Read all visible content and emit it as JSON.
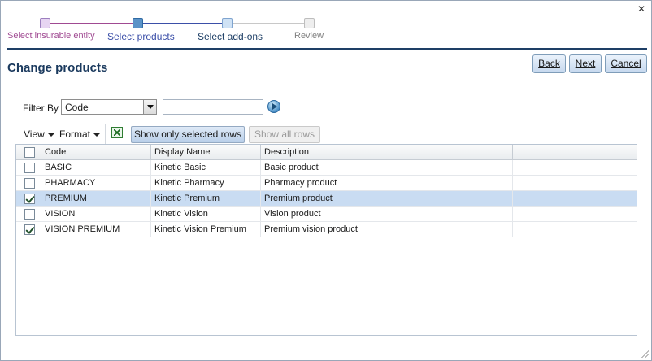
{
  "dialog": {
    "close_glyph": "✕"
  },
  "wizard": {
    "steps": [
      {
        "label": "Select insurable entity",
        "color": "#a04a92",
        "dot_fill": "#e7d5f2",
        "dot_border": "#9c7fbf"
      },
      {
        "label": "Select products",
        "color": "#3b4fa8",
        "dot_fill": "#5b93c8",
        "dot_border": "#2f6aa3"
      },
      {
        "label": "Select add-ons",
        "color": "#1e3f66",
        "dot_fill": "#cfe2f5",
        "dot_border": "#7fa4cf"
      },
      {
        "label": "Review",
        "color": "#808080",
        "dot_fill": "#eeeeee",
        "dot_border": "#bdbdbd"
      }
    ]
  },
  "header": {
    "title": "Change products",
    "buttons": {
      "back": "Back",
      "next": "Next",
      "cancel": "Cancel"
    }
  },
  "filter": {
    "label": "Filter By",
    "selected": "Code",
    "input_value": ""
  },
  "toolbar": {
    "view": "View",
    "format": "Format",
    "export_icon": "excel-icon",
    "show_selected": "Show only selected rows",
    "show_all": "Show all rows"
  },
  "grid": {
    "columns": [
      "Code",
      "Display Name",
      "Description"
    ],
    "rows": [
      {
        "checked": false,
        "code": "BASIC",
        "display_name": "Kinetic Basic",
        "description": "Basic product"
      },
      {
        "checked": false,
        "code": "PHARMACY",
        "display_name": "Kinetic Pharmacy",
        "description": "Pharmacy product"
      },
      {
        "checked": true,
        "code": "PREMIUM",
        "display_name": "Kinetic Premium",
        "description": "Premium product",
        "selected": true
      },
      {
        "checked": false,
        "code": "VISION",
        "display_name": "Kinetic Vision",
        "description": "Vision product"
      },
      {
        "checked": true,
        "code": "VISION PREMIUM",
        "display_name": "Kinetic Vision Premium",
        "description": "Premium vision product"
      }
    ]
  },
  "colors": {
    "accent": "#1e3f66",
    "title": "#1b3a5e",
    "row_selected": "#c9dcf2"
  }
}
